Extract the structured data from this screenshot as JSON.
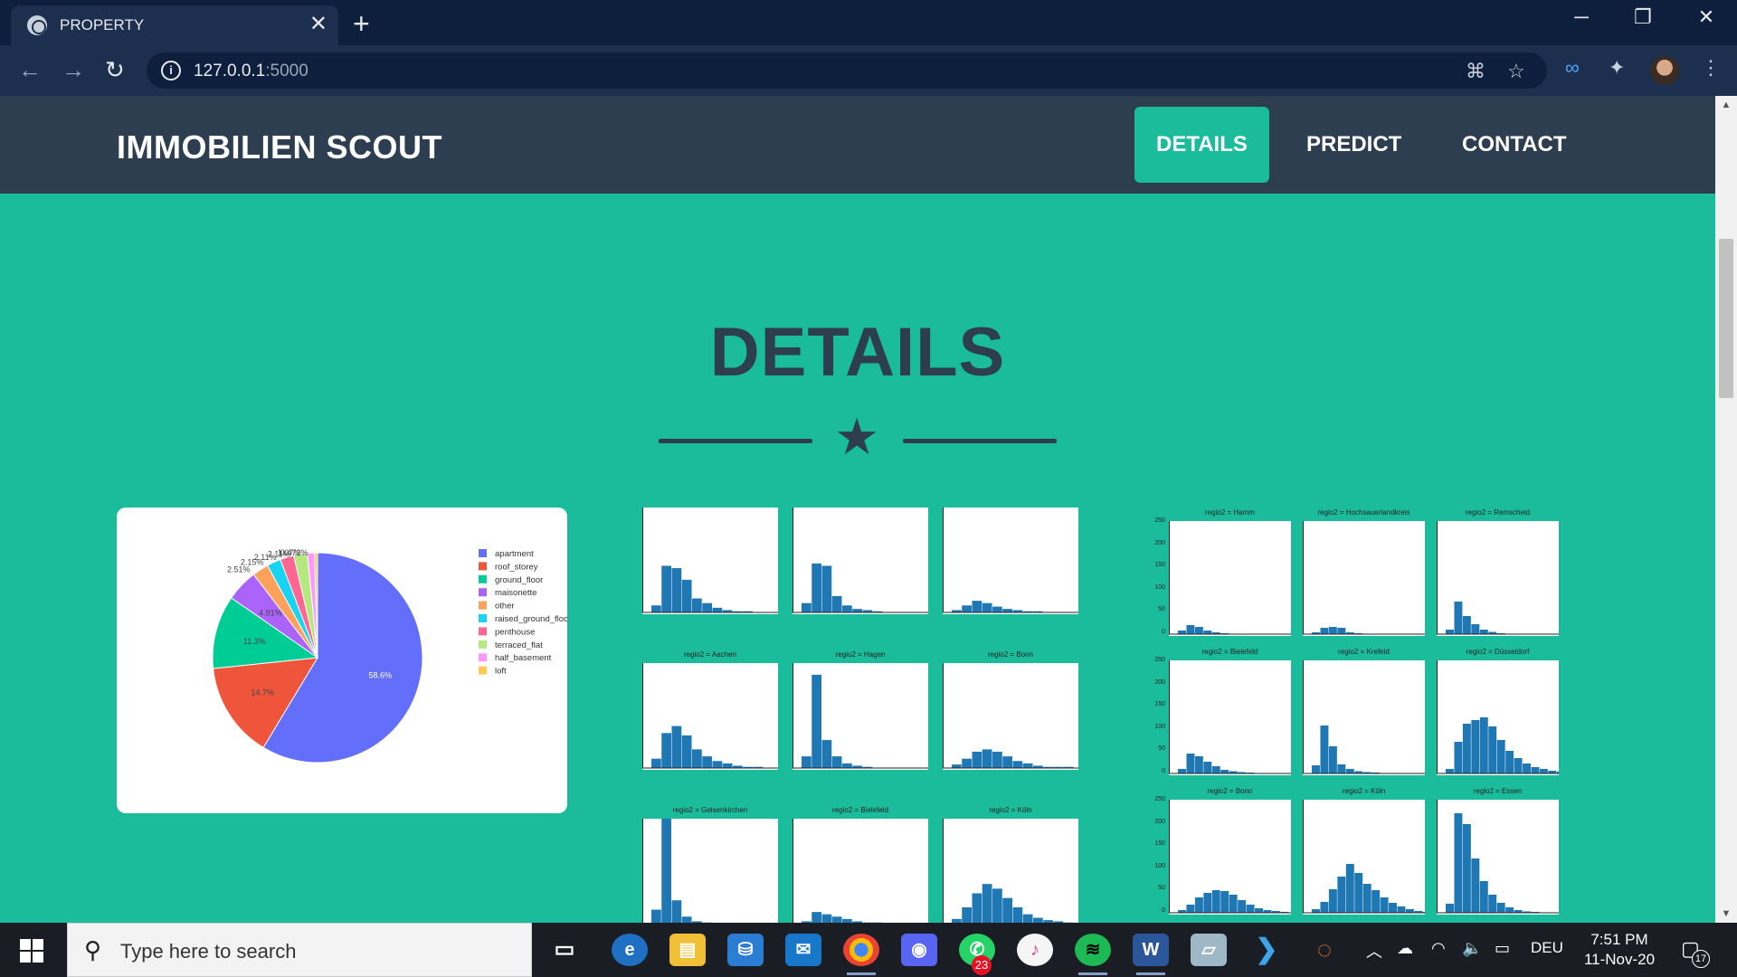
{
  "browser": {
    "tab_title": "PROPERTY",
    "url_host": "127.0.0.1",
    "url_port": ":5000",
    "new_tab_symbol": "+",
    "close_symbol": "✕"
  },
  "site": {
    "brand": "IMMOBILIEN SCOUT",
    "nav": [
      {
        "label": "DETAILS",
        "active": true
      },
      {
        "label": "PREDICT",
        "active": false
      },
      {
        "label": "CONTACT",
        "active": false
      }
    ],
    "section_title": "DETAILS",
    "colors": {
      "primary": "#1abc9c",
      "secondary": "#2c3e50"
    }
  },
  "pie_chart": {
    "type": "pie",
    "legend": [
      "apartment",
      "roof_storey",
      "ground_floor",
      "maisonette",
      "other",
      "raised_ground_floor",
      "penthouse",
      "terraced_flat",
      "half_basement",
      "loft"
    ],
    "values": [
      58.6,
      14.7,
      11.3,
      4.91,
      2.51,
      2.15,
      2.11,
      2.11,
      1.07,
      0.472
    ],
    "labels": [
      "58.6%",
      "14.7%",
      "11.3%",
      "4.91%",
      "2.51%",
      "2.15%",
      "2.11%",
      "2.11%",
      "1.07%",
      "0.472%"
    ],
    "colors": [
      "#636efa",
      "#ef553b",
      "#00cc96",
      "#ab63fa",
      "#ffa15a",
      "#19d3f3",
      "#ff6692",
      "#b6e880",
      "#ff97ff",
      "#fecb52"
    ]
  },
  "hist_grid_1": {
    "titles": [
      "",
      "",
      "",
      "regio2 = Aachen",
      "regio2 = Hagen",
      "regio2 = Bonn",
      "regio2 = Gelsenkirchen",
      "regio2 = Bielefeld",
      "regio2 = Köln"
    ],
    "panels": [
      [
        6,
        40,
        38,
        28,
        12,
        8,
        4,
        2,
        1,
        1,
        0,
        0
      ],
      [
        8,
        42,
        40,
        14,
        6,
        3,
        2,
        1,
        0,
        0,
        0,
        0
      ],
      [
        2,
        6,
        10,
        8,
        5,
        3,
        2,
        1,
        1,
        0,
        0,
        0
      ],
      [
        8,
        30,
        36,
        28,
        16,
        10,
        6,
        4,
        2,
        1,
        1,
        0
      ],
      [
        10,
        80,
        24,
        10,
        4,
        2,
        1,
        0,
        0,
        0,
        0,
        0
      ],
      [
        3,
        8,
        14,
        16,
        14,
        10,
        6,
        4,
        2,
        1,
        1,
        1
      ],
      [
        12,
        90,
        20,
        6,
        2,
        1,
        0,
        0,
        0,
        0,
        0,
        0
      ],
      [
        2,
        10,
        8,
        6,
        4,
        2,
        1,
        1,
        0,
        0,
        0,
        0
      ],
      [
        4,
        14,
        26,
        34,
        30,
        22,
        14,
        8,
        5,
        3,
        2,
        1
      ]
    ]
  },
  "hist_grid_2": {
    "titles": [
      "regio2 = Hamm",
      "regio2 = Hochsauerlandkreis",
      "regio2 = Remscheid",
      "regio2 = Bielefeld",
      "regio2 = Krefeld",
      "regio2 = Düsseldorf",
      "regio2 = Bonn",
      "regio2 = Köln",
      "regio2 = Essen"
    ],
    "yticks": [
      "250",
      "200",
      "150",
      "100",
      "50",
      "0"
    ],
    "panels": [
      [
        8,
        20,
        16,
        8,
        4,
        2,
        1,
        0,
        0,
        0,
        0,
        0,
        0,
        0
      ],
      [
        4,
        14,
        16,
        14,
        4,
        2,
        1,
        0,
        0,
        0,
        0,
        0,
        0,
        0
      ],
      [
        10,
        72,
        40,
        22,
        10,
        5,
        2,
        1,
        0,
        0,
        0,
        0,
        0,
        0
      ],
      [
        10,
        44,
        38,
        26,
        16,
        8,
        5,
        3,
        2,
        1,
        0,
        0,
        0,
        0
      ],
      [
        18,
        106,
        60,
        20,
        10,
        5,
        3,
        2,
        1,
        0,
        0,
        0,
        0,
        0
      ],
      [
        10,
        70,
        110,
        118,
        124,
        104,
        74,
        50,
        34,
        22,
        14,
        10,
        6,
        4
      ],
      [
        6,
        18,
        34,
        44,
        50,
        48,
        40,
        28,
        18,
        10,
        6,
        4,
        2,
        1
      ],
      [
        8,
        24,
        52,
        80,
        108,
        88,
        64,
        50,
        34,
        22,
        14,
        8,
        4,
        2
      ],
      [
        20,
        220,
        196,
        120,
        70,
        40,
        22,
        12,
        6,
        3,
        2,
        1,
        0,
        0
      ]
    ]
  },
  "taskbar": {
    "search_placeholder": "Type here to search",
    "language": "DEU",
    "time": "7:51 PM",
    "date": "11-Nov-20",
    "whatsapp_badge": "23",
    "notifications": "17"
  }
}
